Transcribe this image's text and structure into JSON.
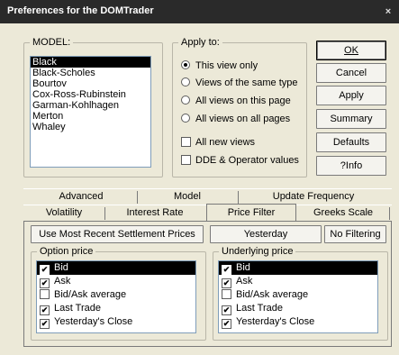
{
  "window": {
    "title": "Preferences for the DOMTrader",
    "close_label": "×"
  },
  "model": {
    "legend": "MODEL:",
    "items": [
      "Black",
      "Black-Scholes",
      "Bourtov",
      "Cox-Ross-Rubinstein",
      "Garman-Kohlhagen",
      "Merton",
      "Whaley"
    ],
    "selected": "Black"
  },
  "apply_to": {
    "legend": "Apply to:",
    "radios": [
      {
        "label": "This view only",
        "checked": true
      },
      {
        "label": "Views of the same type",
        "checked": false
      },
      {
        "label": "All views on this page",
        "checked": false
      },
      {
        "label": "All views on all pages",
        "checked": false
      }
    ],
    "checks": [
      {
        "label": "All new views",
        "checked": false
      },
      {
        "label": "DDE & Operator values",
        "checked": false
      }
    ]
  },
  "buttons": {
    "ok": "OK",
    "cancel": "Cancel",
    "apply": "Apply",
    "summary": "Summary",
    "defaults": "Defaults",
    "info": "?Info"
  },
  "tabs": {
    "back_row": [
      "Advanced",
      "Model",
      "Update Frequency"
    ],
    "front_row": [
      "Volatility",
      "Interest Rate",
      "Price Filter",
      "Greeks Scale"
    ],
    "active": "Price Filter"
  },
  "price_filter": {
    "use_recent": "Use Most Recent Settlement Prices",
    "yesterday": "Yesterday",
    "no_filtering": "No Filtering",
    "option_price": {
      "legend": "Option price",
      "items": [
        {
          "label": "Bid",
          "checked": true,
          "selected": true
        },
        {
          "label": "Ask",
          "checked": true,
          "selected": false
        },
        {
          "label": "Bid/Ask average",
          "checked": false,
          "selected": false
        },
        {
          "label": "Last Trade",
          "checked": true,
          "selected": false
        },
        {
          "label": "Yesterday's Close",
          "checked": true,
          "selected": false
        }
      ]
    },
    "underlying_price": {
      "legend": "Underlying price",
      "items": [
        {
          "label": "Bid",
          "checked": true,
          "selected": true
        },
        {
          "label": "Ask",
          "checked": true,
          "selected": false
        },
        {
          "label": "Bid/Ask average",
          "checked": false,
          "selected": false
        },
        {
          "label": "Last Trade",
          "checked": true,
          "selected": false
        },
        {
          "label": "Yesterday's Close",
          "checked": true,
          "selected": false
        }
      ]
    }
  },
  "check_mark": "✔"
}
